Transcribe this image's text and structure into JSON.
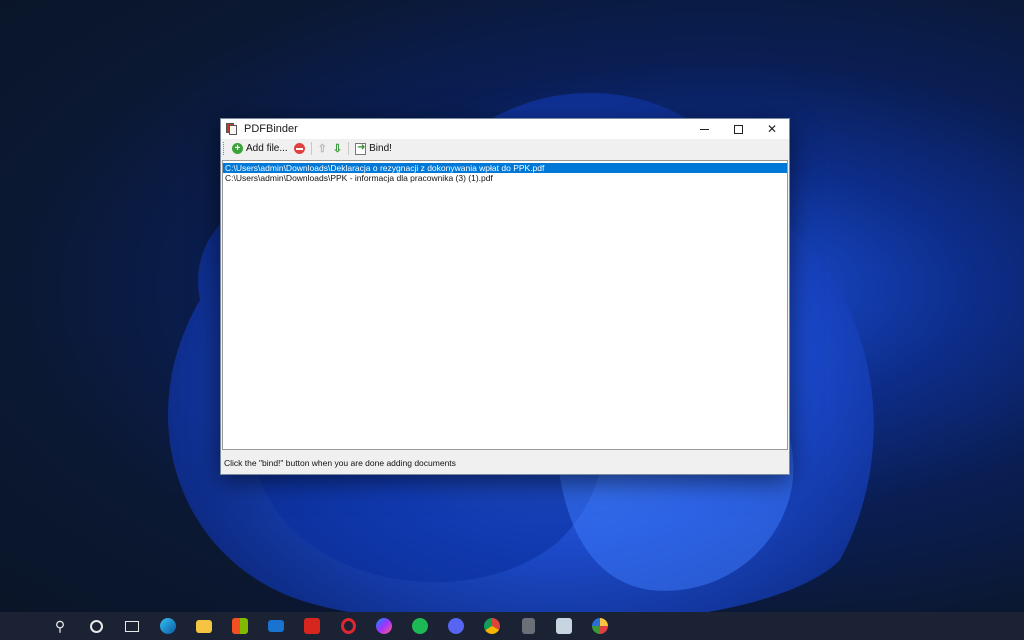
{
  "window": {
    "title": "PDFBinder"
  },
  "toolbar": {
    "add_label": "Add file...",
    "bind_label": "Bind!"
  },
  "files": [
    {
      "path": "C:\\Users\\admin\\Downloads\\Deklaracja o rezygnacji z dokonywania wpłat do PPK.pdf",
      "selected": true
    },
    {
      "path": "C:\\Users\\admin\\Downloads\\PPK - informacja dla pracownika (3) (1).pdf",
      "selected": false
    }
  ],
  "status": {
    "text": "Click the \"bind!\" button when you are done adding documents"
  },
  "taskbar": {
    "icons": [
      "windows-start-icon",
      "search-icon",
      "cortana-icon",
      "task-view-icon",
      "edge-icon",
      "file-explorer-icon",
      "store-icon",
      "mail-icon",
      "wps-office-icon",
      "opera-icon",
      "messenger-icon",
      "spotify-icon",
      "discord-icon",
      "chrome-icon",
      "calculator-icon",
      "steam-icon",
      "paint-icon"
    ]
  },
  "colors": {
    "selection": "#0078d7",
    "taskbar": "#1b2233"
  }
}
